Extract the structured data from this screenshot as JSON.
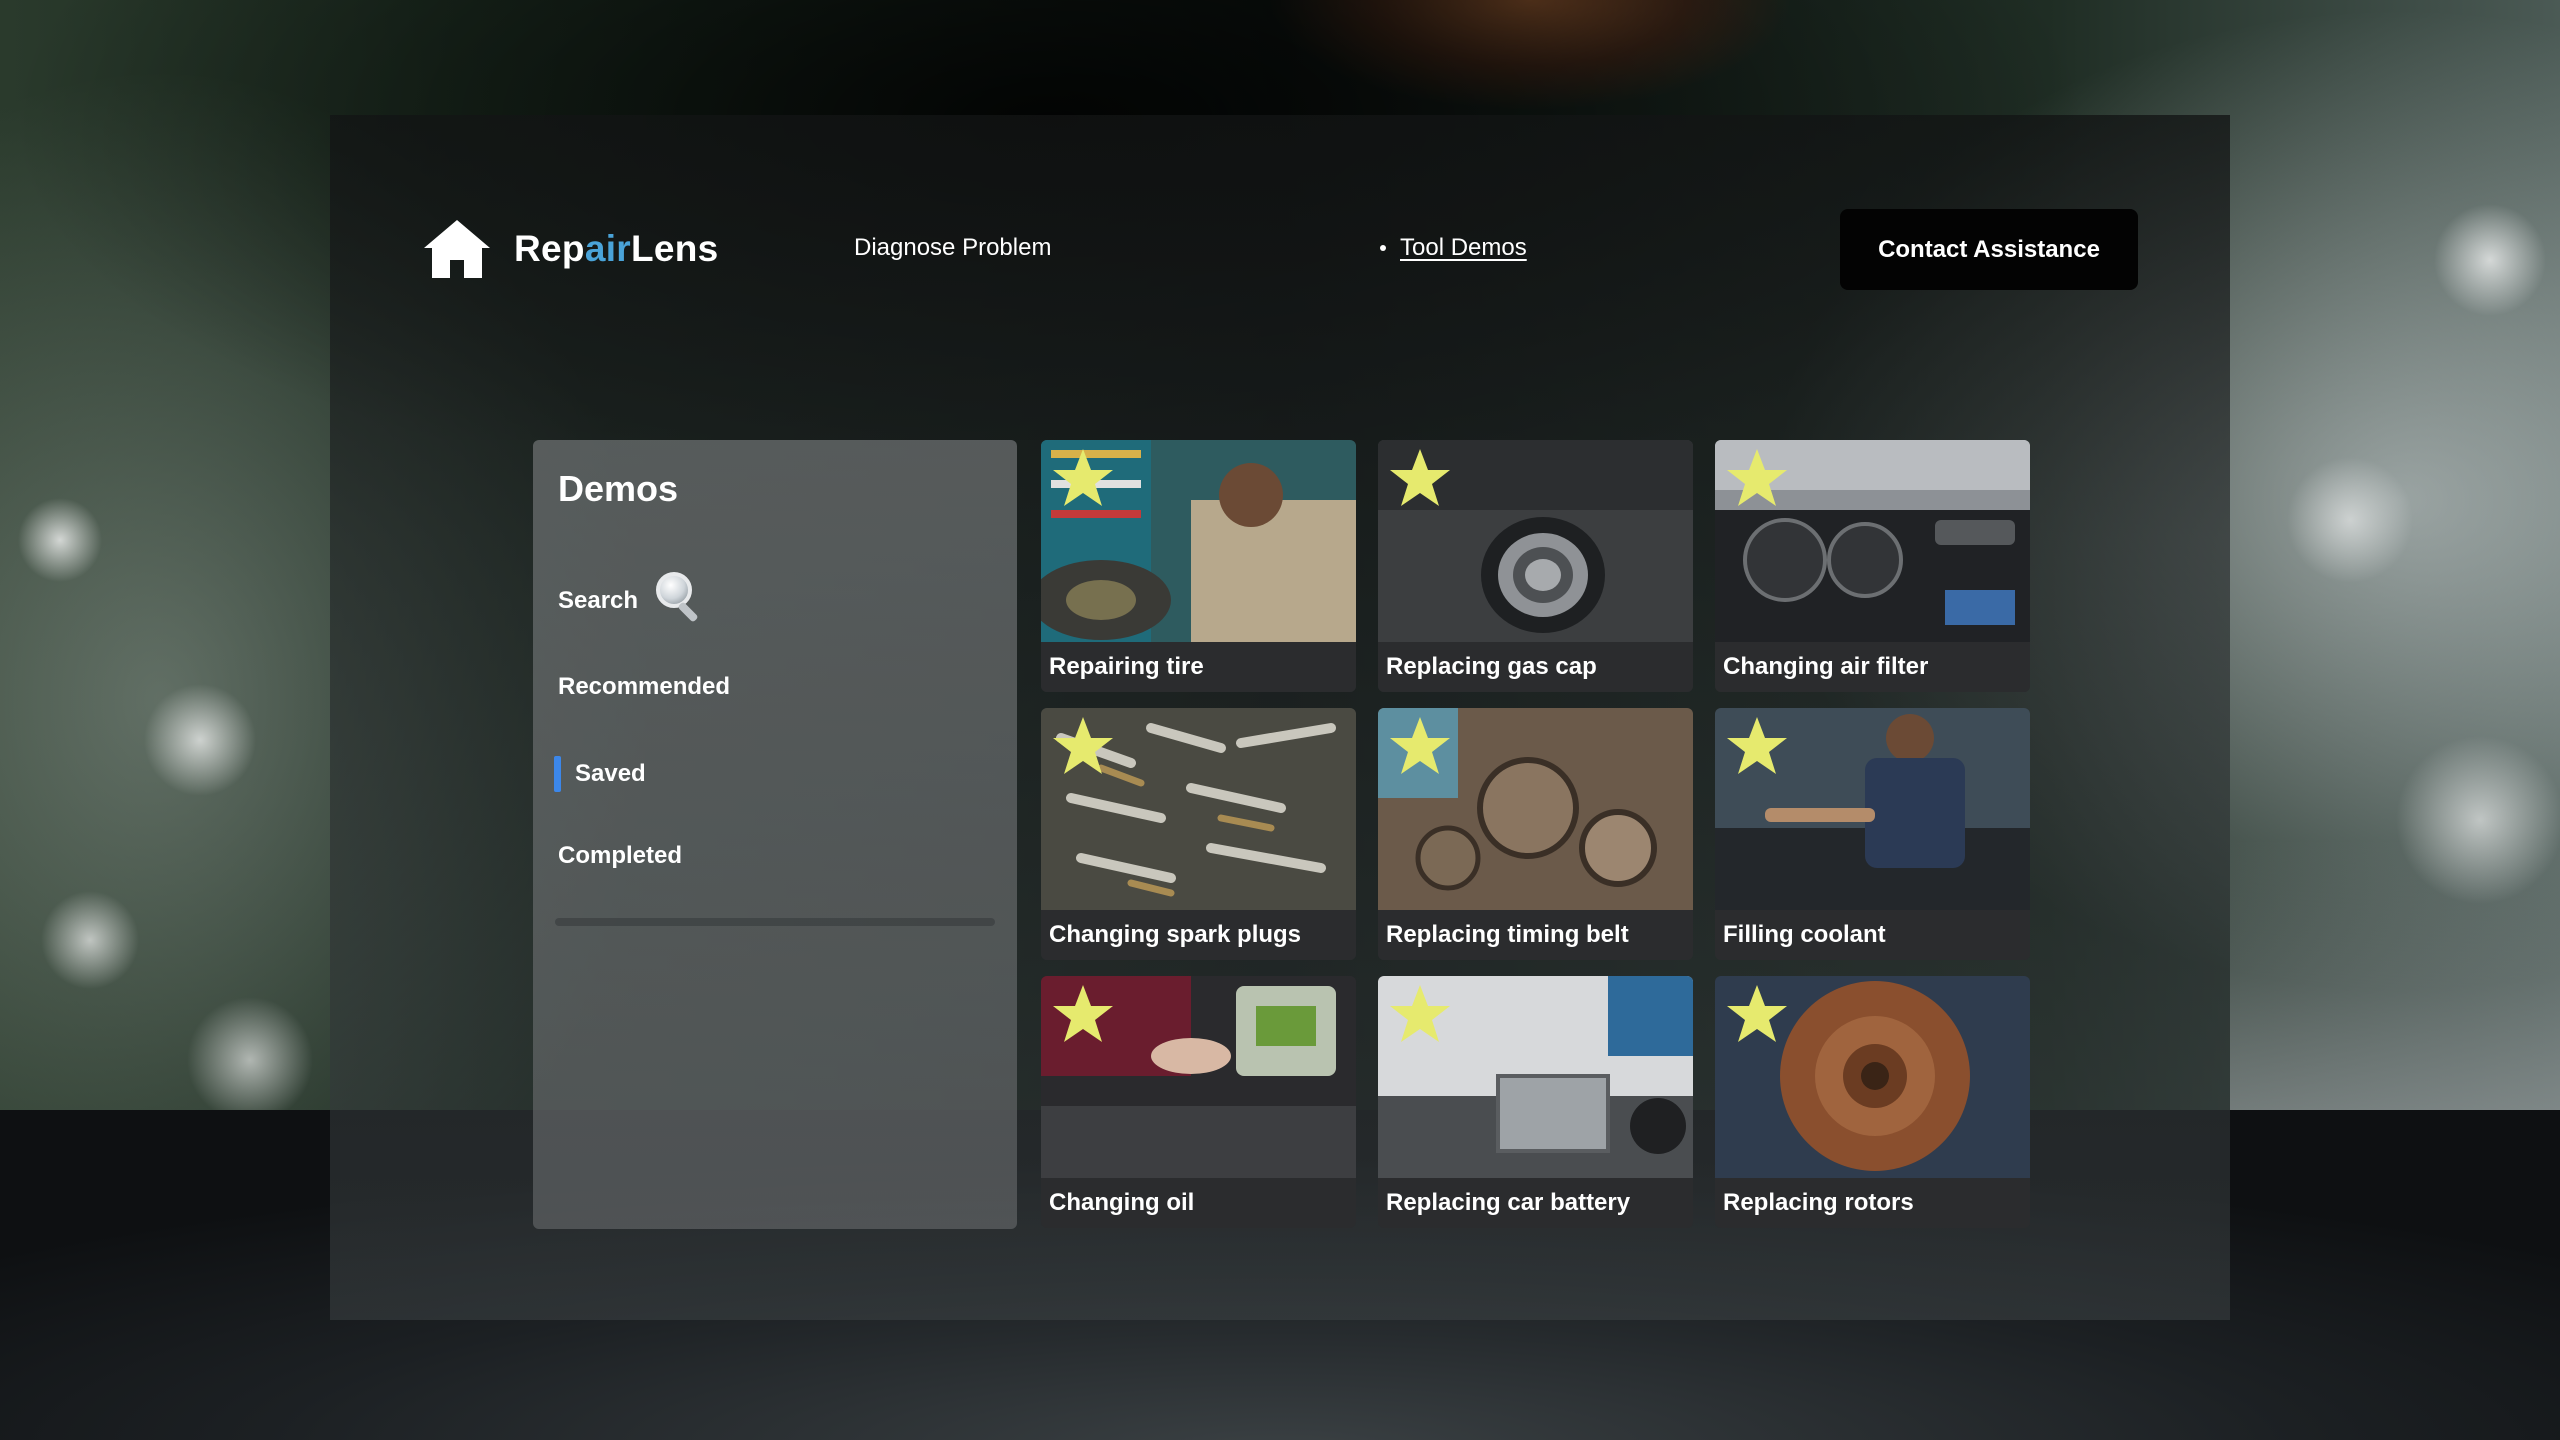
{
  "app": {
    "brand_prefix": "Rep",
    "brand_accent": "air",
    "brand_suffix": "Lens",
    "accent_color": "#4aa3d8"
  },
  "nav": {
    "diagnose": "Diagnose Problem",
    "tool_demos": "Tool Demos",
    "contact": "Contact Assistance"
  },
  "sidebar": {
    "title": "Demos",
    "items": [
      {
        "label": "Search",
        "icon": "magnifier-icon"
      },
      {
        "label": "Recommended"
      },
      {
        "label": "Saved",
        "active": true,
        "indicator_color": "#3c87ea"
      },
      {
        "label": "Completed"
      }
    ]
  },
  "demos": [
    {
      "title": "Repairing tire",
      "starred": true
    },
    {
      "title": "Replacing gas cap",
      "starred": true
    },
    {
      "title": "Changing air filter",
      "starred": true
    },
    {
      "title": "Changing spark plugs",
      "starred": true
    },
    {
      "title": "Replacing timing belt",
      "starred": true
    },
    {
      "title": "Filling coolant",
      "starred": true
    },
    {
      "title": "Changing oil",
      "starred": true
    },
    {
      "title": "Replacing car battery",
      "starred": true
    },
    {
      "title": "Replacing rotors",
      "starred": true
    }
  ],
  "colors": {
    "star": "#e6ea6e",
    "button_bg": "#030303"
  }
}
